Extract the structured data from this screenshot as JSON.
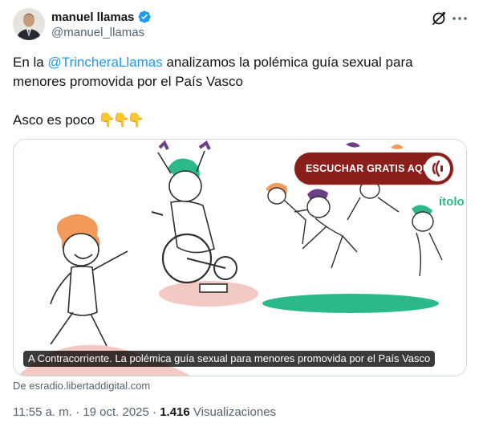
{
  "author": {
    "display_name": "manuel llamas",
    "handle": "@manuel_llamas"
  },
  "icons": {
    "verified": "verified-badge-icon",
    "grok": "grok-icon",
    "more": "more-options-icon",
    "emoji": "backhand-index-pointing-down"
  },
  "tweet": {
    "line1_before": "En la ",
    "mention": "@TrincheraLlamas",
    "line1_after": " analizamos la polémica guía sexual para",
    "line2": "menores promovida por el País Vasco",
    "line3": "Asco es poco",
    "emojis": [
      "👇",
      "👇",
      "👇"
    ]
  },
  "card": {
    "badge_label": "ESCUCHAR GRATIS AQUÍ",
    "partial_logo_text": "ítolo",
    "caption": "A Contracorriente. La polémica guía sexual para menores promovida por el País Vasco",
    "source": "De esradio.libertaddigital.com"
  },
  "meta": {
    "time": "11:55 a. m.",
    "separator": "·",
    "date": "19 oct. 2025",
    "views_count": "1.416",
    "views_label": "Visualizaciones"
  },
  "colors": {
    "text": "#0f1419",
    "secondary": "#536471",
    "link": "#1d9bf0",
    "badge": "#8a1e1b",
    "green": "#2bb98b"
  }
}
